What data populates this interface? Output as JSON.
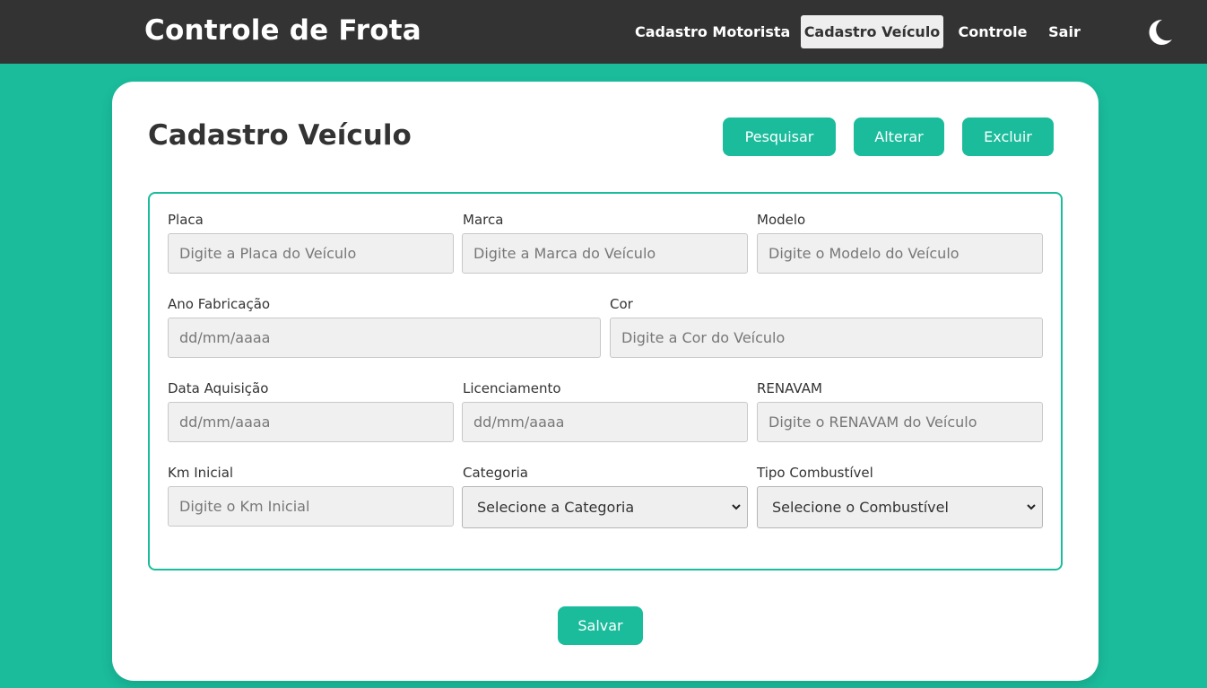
{
  "header": {
    "brand": "Controle de Frota",
    "nav": [
      {
        "label": "Cadastro Motorista",
        "active": false
      },
      {
        "label": "Cadastro Veículo",
        "active": true
      },
      {
        "label": "Controle",
        "active": false
      },
      {
        "label": "Sair",
        "active": false
      }
    ],
    "theme_icon": "moon-icon"
  },
  "page": {
    "title": "Cadastro Veículo",
    "actions": {
      "search": "Pesquisar",
      "edit": "Alterar",
      "delete": "Excluir"
    },
    "save": "Salvar"
  },
  "form": {
    "placa": {
      "label": "Placa",
      "placeholder": "Digite a Placa do Veículo"
    },
    "marca": {
      "label": "Marca",
      "placeholder": "Digite a Marca do Veículo"
    },
    "modelo": {
      "label": "Modelo",
      "placeholder": "Digite o Modelo do Veículo"
    },
    "ano_fabricacao": {
      "label": "Ano Fabricação",
      "placeholder": "dd/mm/aaaa"
    },
    "cor": {
      "label": "Cor",
      "placeholder": "Digite a Cor do Veículo"
    },
    "data_aquisicao": {
      "label": "Data Aquisição",
      "placeholder": "dd/mm/aaaa"
    },
    "licenciamento": {
      "label": "Licenciamento",
      "placeholder": "dd/mm/aaaa"
    },
    "renavam": {
      "label": "RENAVAM",
      "placeholder": "Digite o RENAVAM do Veículo"
    },
    "km_inicial": {
      "label": "Km Inicial",
      "placeholder": "Digite o Km Inicial"
    },
    "categoria": {
      "label": "Categoria",
      "selected": "Selecione a Categoria"
    },
    "tipo_combustivel": {
      "label": "Tipo Combustível",
      "selected": "Selecione o Combustível"
    }
  },
  "colors": {
    "primary": "#1abc9c",
    "navbar": "#333333",
    "card": "#ffffff",
    "input_bg": "#f0f0f0"
  }
}
